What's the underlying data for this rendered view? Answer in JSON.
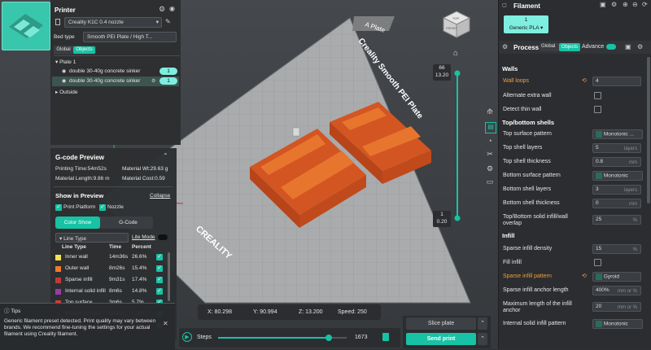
{
  "printer": {
    "title": "Printer",
    "printer_name": "Creality K1C 0.4 nozzle",
    "bed_type_label": "Bed type",
    "bed_type_value": "Smooth PEI Plate / High T...",
    "tab_global": "Global",
    "tab_objects": "Objects",
    "tree": {
      "plate": "Plate 1",
      "objects": [
        {
          "name": "double 30-40g concrete sinker",
          "badge": "1"
        },
        {
          "name": "double 30-40g concrete sinker",
          "badge": "1"
        }
      ],
      "outside": "Outside"
    }
  },
  "gcode": {
    "title": "G-code Preview",
    "printing_time": "Printing Time:54m52s",
    "material_wt": "Material Wt:29.63 g",
    "material_length": "Material Length:9.86 m",
    "material_cost": "Material Cost:0.59",
    "show_title": "Show in Preview",
    "collapse": "Collapse",
    "print_platform": "Print Platform",
    "nozzle": "Nozzle",
    "tab_color": "Color Show",
    "tab_gcode": "G-Code",
    "line_type_select": "Line Type",
    "lite_mode": "Lite Mode",
    "col_line_type": "Line Type",
    "col_time": "Time",
    "col_percent": "Percent",
    "rows": [
      {
        "name": "Inner wall",
        "time": "14m36s",
        "percent": "26.6%",
        "color": "#f5e34a"
      },
      {
        "name": "Outer wall",
        "time": "8m26s",
        "percent": "15.4%",
        "color": "#f07a2a"
      },
      {
        "name": "Sparse infill",
        "time": "9m31s",
        "percent": "17.4%",
        "color": "#c23a3a"
      },
      {
        "name": "Internal solid infill",
        "time": "8m6s",
        "percent": "14.8%",
        "color": "#9a3aa8"
      },
      {
        "name": "Top surface",
        "time": "3m6s",
        "percent": "5.7%",
        "color": "#d23a3a"
      },
      {
        "name": "Bottom surface",
        "time": "3m26s",
        "percent": "6.3%",
        "color": "#6a3a3a"
      },
      {
        "name": "",
        "time": "",
        "percent": "0.8%",
        "color": "#3a6ad2"
      }
    ]
  },
  "tip": {
    "title": "Tips",
    "text": "Generic filament preset detected. Print quality may vary between brands. We recommend fine-tuning the settings for your actual filament using Creality filament."
  },
  "viewport": {
    "plate_label": "A Plate",
    "bed_text": "Creality Smooth PEI Plate",
    "brand": "CREALITY",
    "layer_top_num": "66",
    "layer_top_h": "13.20",
    "layer_bot_num": "1",
    "layer_bot_h": "0.20",
    "cube_top": "TOP",
    "cube_front": "FRONT"
  },
  "coords": {
    "x": "X: 80.298",
    "y": "Y: 90.994",
    "z": "Z: 13.200",
    "speed": "Speed: 250"
  },
  "steps": {
    "label": "Steps",
    "value": "1673",
    "fraction": 0.86
  },
  "actions": {
    "slice": "Slice plate",
    "send": "Send print"
  },
  "filament": {
    "title": "Filament",
    "slot_num": "1",
    "slot_name": "Generic PLA"
  },
  "process": {
    "title": "Process",
    "tab_global": "Global",
    "tab_objects": "Objects",
    "advance": "Advance",
    "walls_title": "Walls",
    "wall_loops": "Wall loops",
    "wall_loops_val": "4",
    "alternate_extra_wall": "Alternate extra wall",
    "detect_thin_wall": "Detect thin wall",
    "topbottom_title": "Top/bottom shells",
    "top_surface_pattern": "Top surface pattern",
    "top_surface_pattern_val": "Monotonic ...",
    "top_shell_layers": "Top shell layers",
    "top_shell_layers_val": "5",
    "top_shell_thickness": "Top shell thickness",
    "top_shell_thickness_val": "0.8",
    "bottom_surface_pattern": "Bottom surface pattern",
    "bottom_surface_pattern_val": "Monotonic",
    "bottom_shell_layers": "Bottom shell layers",
    "bottom_shell_layers_val": "3",
    "bottom_shell_thickness": "Bottom shell thickness",
    "bottom_shell_thickness_val": "0",
    "topbottom_overlap": "Top/Bottom solid infill/wall overlap",
    "topbottom_overlap_val": "25",
    "infill_title": "Infill",
    "sparse_density": "Sparse infill density",
    "sparse_density_val": "15",
    "fill": "Fill infill",
    "sparse_pattern": "Sparse infill pattern",
    "sparse_pattern_val": "Gyroid",
    "anchor_length": "Sparse infill anchor length",
    "anchor_length_val": "400%",
    "anchor_max": "Maximum length of the infill anchor",
    "anchor_max_val": "20",
    "internal_solid_pattern": "Internal solid infill pattern",
    "internal_solid_pattern_val": "Monotonic",
    "units": {
      "layers": "layers",
      "mm": "mm",
      "pct": "%",
      "mm_or_pct": "mm or %"
    }
  },
  "colors": {
    "accent": "#17c2a5",
    "model": "#e0642a",
    "bed": "#a7a9ab"
  }
}
